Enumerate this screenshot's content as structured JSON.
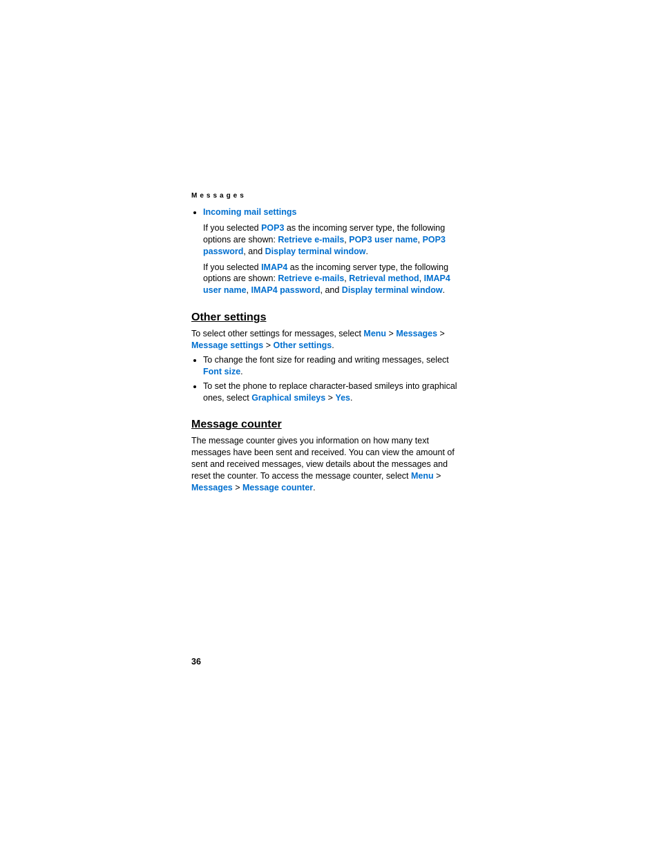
{
  "header": "Messages",
  "bullet1": {
    "title": "Incoming mail settings",
    "p1": {
      "t1": "If you selected ",
      "pop3": "POP3",
      "t2": " as the incoming server type, the following options are shown: ",
      "opt1": "Retrieve e-mails",
      "c1": ", ",
      "opt2": "POP3 user name",
      "c2": ", ",
      "opt3": "POP3 password",
      "c3": ", and ",
      "opt4": "Display terminal window",
      "end": "."
    },
    "p2": {
      "t1": "If you selected ",
      "imap4": "IMAP4",
      "t2": " as the incoming server type, the following options are shown: ",
      "opt1": "Retrieve e-mails",
      "c1": ", ",
      "opt2": "Retrieval method",
      "c2": ", ",
      "opt3": "IMAP4 user name",
      "c3": ", ",
      "opt4": "IMAP4 password",
      "c4": ", and ",
      "opt5": "Display terminal window",
      "end": "."
    }
  },
  "other": {
    "heading": "Other settings",
    "intro": {
      "t1": "To select other settings for messages, select ",
      "menu": "Menu",
      "gt1": " > ",
      "messages": "Messages",
      "gt2": " > ",
      "msettings": "Message settings",
      "gt3": " > ",
      "osettings": "Other settings",
      "end": "."
    },
    "li1": {
      "t1": "To change the font size for reading and writing messages, select ",
      "font": "Font size",
      "end": "."
    },
    "li2": {
      "t1": "To set the phone to replace character-based smileys into graphical ones, select ",
      "gs": "Graphical smileys",
      "gt": " > ",
      "yes": "Yes",
      "end": "."
    }
  },
  "counter": {
    "heading": "Message counter",
    "body": {
      "t1": "The message counter gives you information on how many text messages have been sent and received. You can view the amount of sent and received messages, view details about the messages and reset the counter. To access the message counter, select ",
      "menu": "Menu",
      "gt1": " > ",
      "messages": "Messages",
      "gt2": " > ",
      "mc": "Message counter",
      "end": "."
    }
  },
  "pageNumber": "36"
}
